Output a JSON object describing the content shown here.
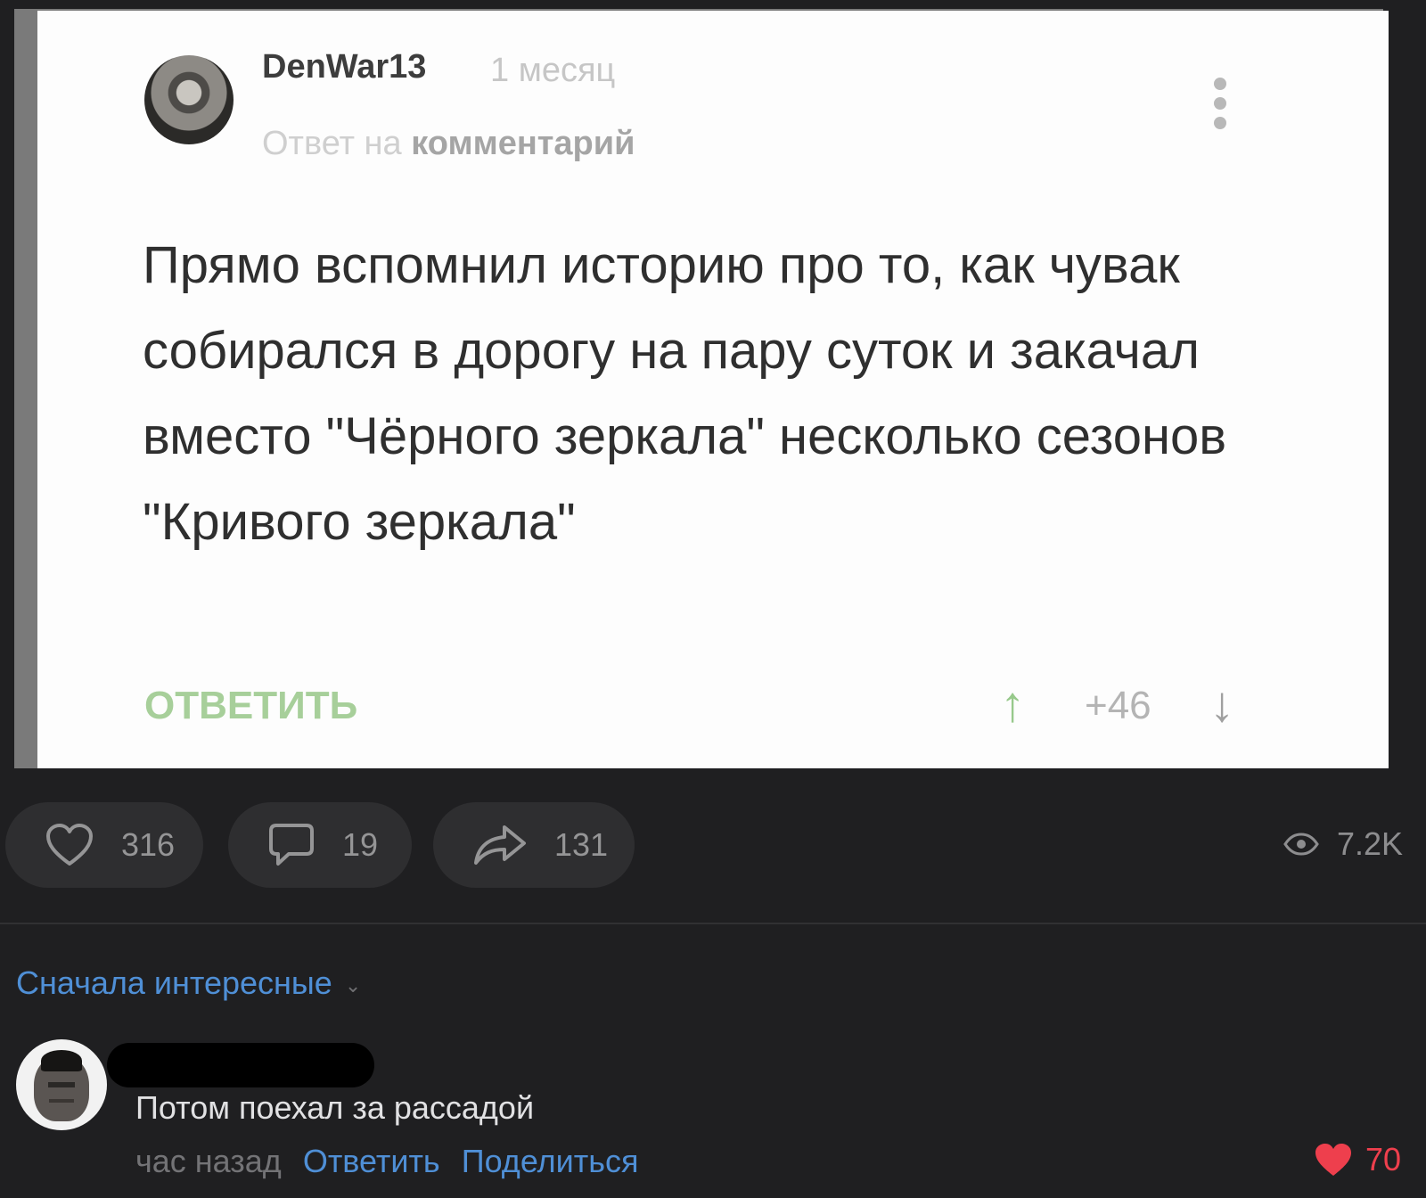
{
  "screenshot": {
    "author": "DenWar13",
    "time": "1 месяц",
    "reply_to_prefix": "Ответ на",
    "reply_to_target": "комментарий",
    "body": "Прямо вспомнил историю про то, как чувак собирался в дорогу на пару суток и закачал вместо \"Чёрного зеркала\" несколько сезонов \"Кривого зеркала\"",
    "reply_label": "ОТВЕТИТЬ",
    "score": "+46",
    "up_arrow": "↑",
    "down_arrow": "↓"
  },
  "actions": {
    "likes": "316",
    "comments": "19",
    "shares": "131",
    "views": "7.2K"
  },
  "sort": {
    "label": "Сначала интересные",
    "chevron": "⌄"
  },
  "comment": {
    "text": "Потом поехал за рассадой",
    "time": "час назад",
    "reply_label": "Ответить",
    "share_label": "Поделиться",
    "likes": "70"
  },
  "colors": {
    "background": "#1f1f21",
    "link": "#4f8fd6",
    "like_red": "#ee3f4d",
    "reply_green": "#a7cf9a"
  },
  "icons": [
    "more-vertical-icon",
    "arrow-up-icon",
    "arrow-down-icon",
    "heart-icon",
    "comment-icon",
    "share-icon",
    "eye-icon",
    "chevron-down-icon"
  ]
}
